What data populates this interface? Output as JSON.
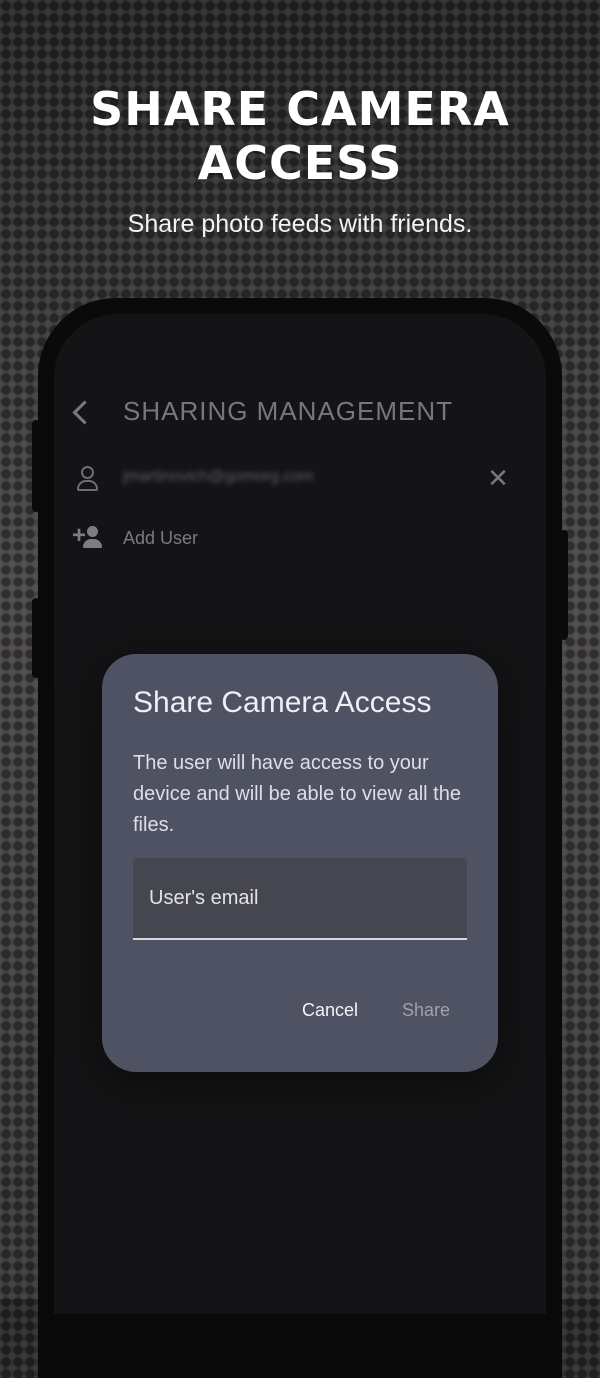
{
  "headline": {
    "line1": "SHARE CAMERA",
    "line2": "ACCESS"
  },
  "subheadline": "Share photo feeds with friends.",
  "app": {
    "title": "SHARING MANAGEMENT",
    "shared_user_email": "jmartinovich@gomorg.com",
    "add_user_label": "Add User"
  },
  "dialog": {
    "title": "Share Camera Access",
    "body": "The user will have access to your device and will be able to view all the files.",
    "email_placeholder": "User's email",
    "email_value": "",
    "cancel_label": "Cancel",
    "share_label": "Share"
  },
  "icons": {
    "back": "chevron-left-icon",
    "user": "person-outline-icon",
    "remove": "close-icon",
    "add_user": "person-add-icon"
  },
  "colors": {
    "dialog_background": "#4f5262",
    "screen_background": "#141416",
    "share_disabled": "#9ea1ad"
  }
}
